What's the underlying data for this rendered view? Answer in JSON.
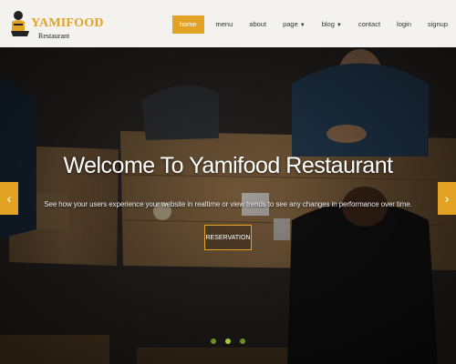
{
  "brand": {
    "name": "YAMIFOOD",
    "tagline": "Restaurant",
    "accent": "#e2a325"
  },
  "nav": {
    "items": [
      {
        "label": "home",
        "active": true
      },
      {
        "label": "menu"
      },
      {
        "label": "about"
      },
      {
        "label": "page",
        "dropdown": true
      },
      {
        "label": "blog",
        "dropdown": true
      },
      {
        "label": "contact"
      },
      {
        "label": "login"
      },
      {
        "label": "signup"
      }
    ]
  },
  "hero": {
    "title": "Welcome To Yamifood Restaurant",
    "subtitle": "See how your users experience your website in realtime or view trends to see any changes in performance over time.",
    "button": "RESERVATION",
    "prev_icon": "chevron-left-icon",
    "next_icon": "chevron-right-icon",
    "slides": 3,
    "active_slide": 1
  }
}
